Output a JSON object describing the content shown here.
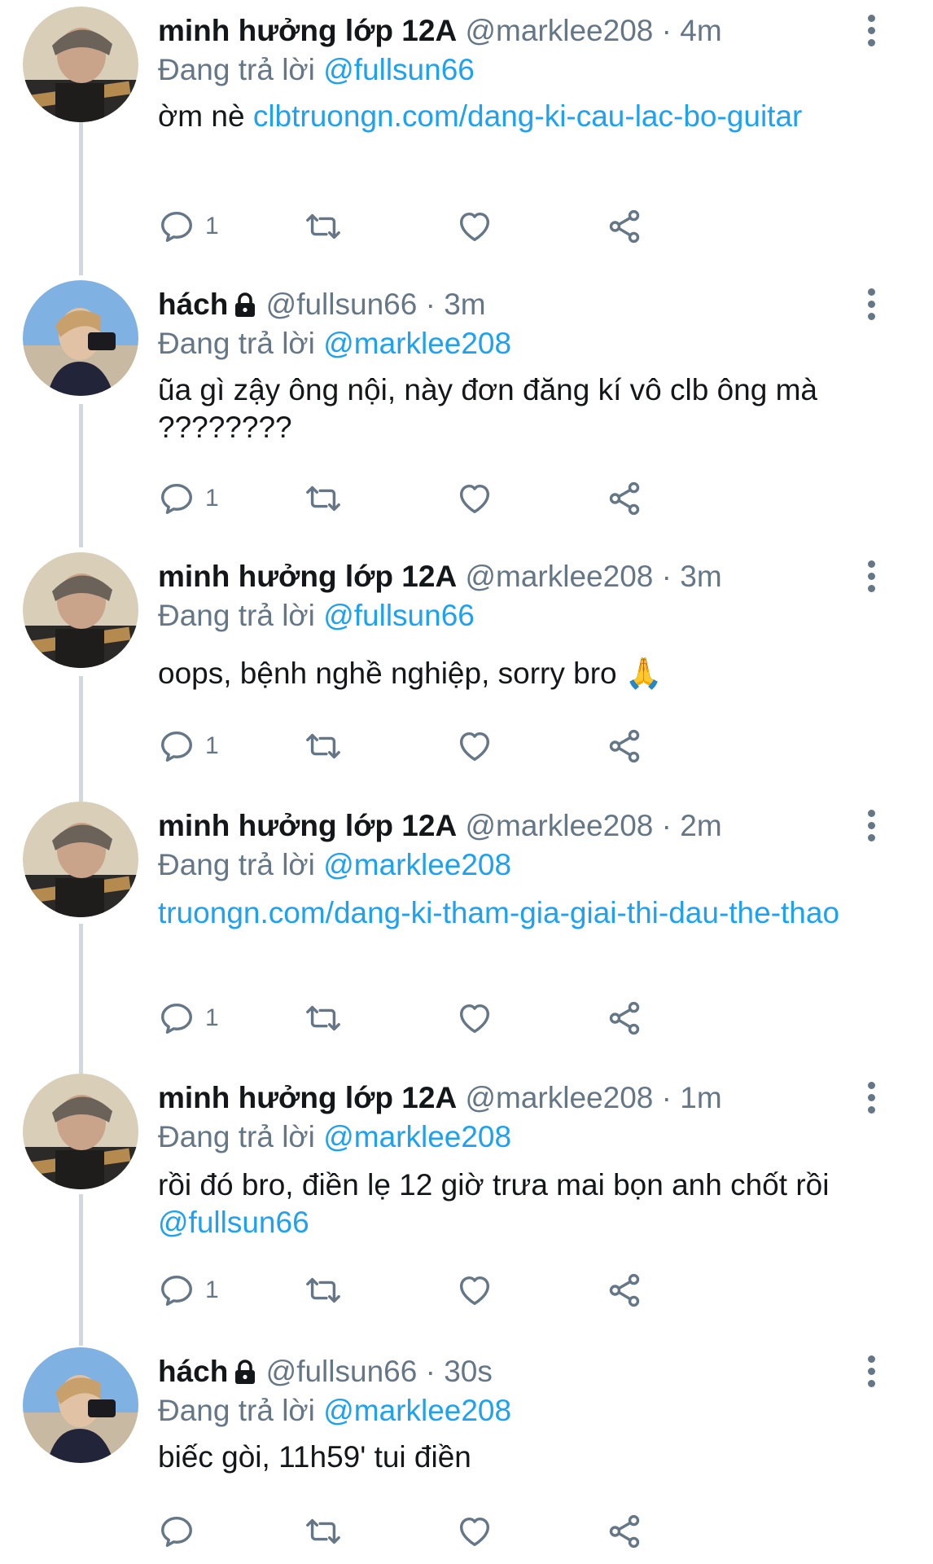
{
  "colors": {
    "accent": "#1da1f2",
    "muted": "#657786",
    "text": "#14171a",
    "thread_line": "#cfd9de"
  },
  "icons": {
    "reply": "reply-icon",
    "retweet": "retweet-icon",
    "like": "heart-icon",
    "share": "share-icon",
    "more": "more-vertical-icon",
    "lock": "lock-icon"
  },
  "tweets": [
    {
      "name": "minh hưởng lớp 12A",
      "handle": "@marklee208",
      "dot": "·",
      "time": "4m",
      "replying_prefix": "Đang trả lời",
      "replying_to": "@fullsun66",
      "text_before": "ờm nè ",
      "link": "clbtruongn.com/dang-ki-cau-lac-bo-guitar",
      "text_after": "",
      "reply_count": "1"
    },
    {
      "name": "hách",
      "handle": "@fullsun66",
      "dot": "·",
      "time": "3m",
      "replying_prefix": "Đang trả lời",
      "replying_to": "@marklee208",
      "text_before": "ũa gì zậy ông nội, này đơn đăng kí vô clb ông mà ????????",
      "link": "",
      "text_after": "",
      "reply_count": "1"
    },
    {
      "name": "minh hưởng lớp 12A",
      "handle": "@marklee208",
      "dot": "·",
      "time": "3m",
      "replying_prefix": "Đang trả lời",
      "replying_to": "@fullsun66",
      "text_before": "oops, bệnh nghề nghiệp, sorry bro 🙏",
      "link": "",
      "text_after": "",
      "reply_count": "1"
    },
    {
      "name": "minh hưởng lớp 12A",
      "handle": "@marklee208",
      "dot": "·",
      "time": "2m",
      "replying_prefix": "Đang trả lời",
      "replying_to": "@marklee208",
      "text_before": "",
      "link": "truongn.com/dang-ki-tham-gia-giai-thi-dau-the-thao",
      "text_after": "",
      "reply_count": "1"
    },
    {
      "name": "minh hưởng lớp 12A",
      "handle": "@marklee208",
      "dot": "·",
      "time": "1m",
      "replying_prefix": "Đang trả lời",
      "replying_to": "@marklee208",
      "text_before": "rồi đó bro, điền lẹ 12 giờ trưa mai bọn anh chốt rồi ",
      "link": "@fullsun66",
      "text_after": "",
      "reply_count": "1"
    },
    {
      "name": "hách",
      "handle": "@fullsun66",
      "dot": "·",
      "time": "30s",
      "replying_prefix": "Đang trả lời",
      "replying_to": "@marklee208",
      "text_before": "biếc gòi, 11h59' tui điền",
      "link": "",
      "text_after": "",
      "reply_count": ""
    }
  ]
}
